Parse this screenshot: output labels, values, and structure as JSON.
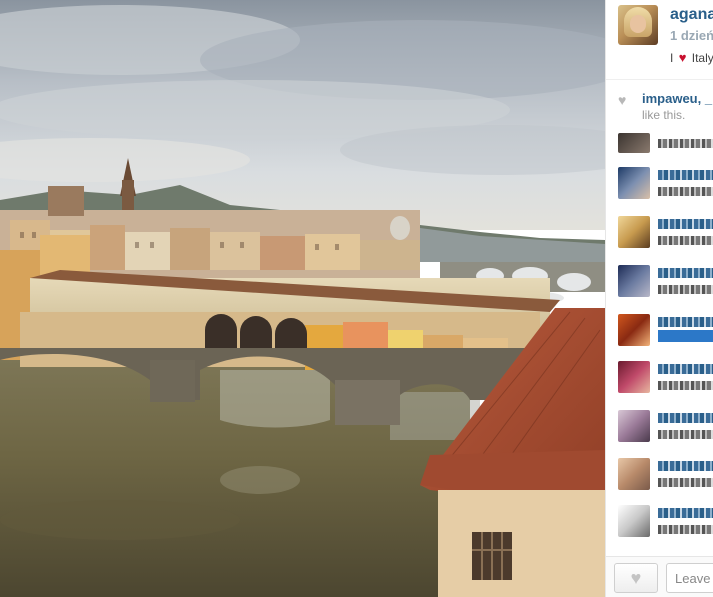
{
  "post": {
    "username": "agana",
    "time_ago": "1 dzień",
    "caption_prefix": "I",
    "caption_suffix": "Italy"
  },
  "likes": {
    "who": "impaweu, _",
    "tail": "like this."
  },
  "footer": {
    "like_button_icon": "heart-icon",
    "comment_placeholder": "Leave a comment..."
  },
  "colors": {
    "username": "#2a5f8a",
    "highlight": "#2c78c8",
    "caption_heart": "#c8102e"
  }
}
